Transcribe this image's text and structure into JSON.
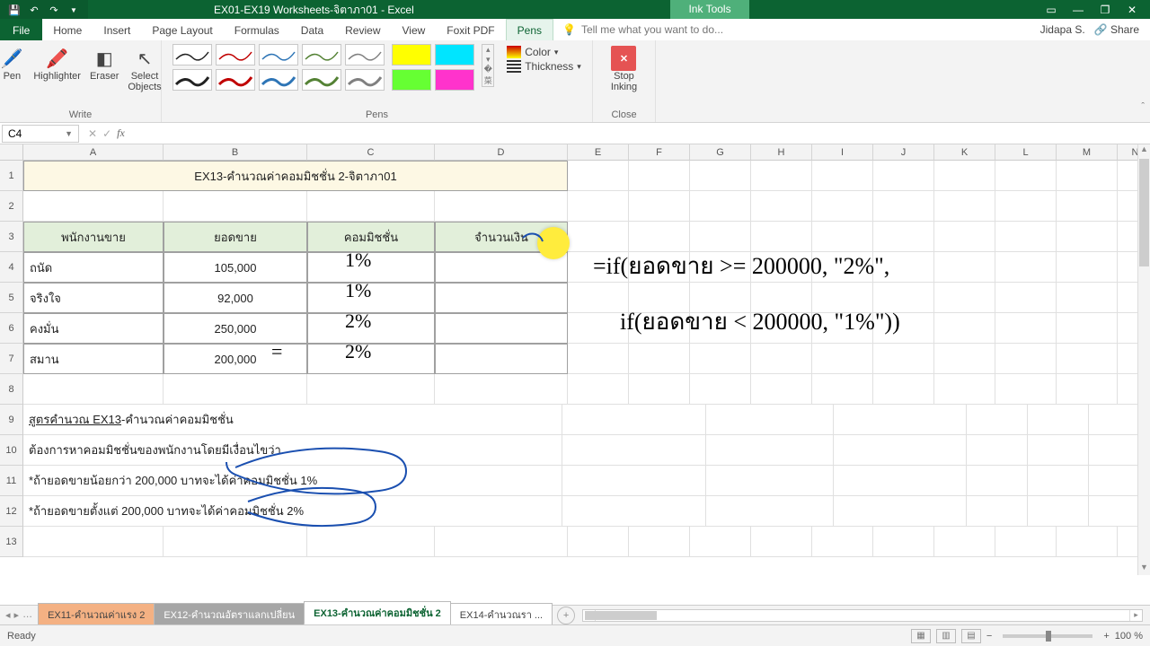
{
  "title": "EX01-EX19  Worksheets-จิตาภา01 - Excel",
  "context_tab": "Ink Tools",
  "user": "Jidapa S.",
  "share": "Share",
  "menutabs": [
    "File",
    "Home",
    "Insert",
    "Page Layout",
    "Formulas",
    "Data",
    "Review",
    "View",
    "Foxit PDF",
    "Pens"
  ],
  "active_tab": "Pens",
  "tellme_placeholder": "Tell me what you want to do...",
  "ribbon": {
    "write": {
      "pen": "Pen",
      "high": "Highlighter",
      "eraser": "Eraser",
      "select": "Select\nObjects",
      "label": "Write"
    },
    "pens_label": "Pens",
    "color": "Color",
    "thickness": "Thickness",
    "stop": "Stop\nInking",
    "close_label": "Close"
  },
  "namebox": "C4",
  "colwidths": {
    "A": 156,
    "B": 160,
    "C": 142,
    "D": 148,
    "E": 68,
    "F": 68,
    "G": 68,
    "H": 68,
    "I": 68,
    "J": 68,
    "K": 68,
    "L": 68,
    "M": 68,
    "N": 40
  },
  "columns": [
    "A",
    "B",
    "C",
    "D",
    "E",
    "F",
    "G",
    "H",
    "I",
    "J",
    "K",
    "L",
    "M",
    "N"
  ],
  "rows": [
    "1",
    "2",
    "3",
    "4",
    "5",
    "6",
    "7",
    "8",
    "9",
    "10",
    "11",
    "12",
    "13"
  ],
  "sheet": {
    "title": "EX13-คำนวณค่าคอมมิชชั่น 2-จิตาภา01",
    "headers": {
      "a": "พนักงานขาย",
      "b": "ยอดขาย",
      "c": "คอมมิชชั่น",
      "d": "จำนวนเงิน"
    },
    "r4": {
      "a": "ถนัด",
      "b": "105,000"
    },
    "r5": {
      "a": "จริงใจ",
      "b": "92,000"
    },
    "r6": {
      "a": "คงมั่น",
      "b": "250,000"
    },
    "r7": {
      "a": "สมาน",
      "b": "200,000"
    },
    "r9": "สูตรคำนวณ EX13-คำนวณค่าคอมมิชชั่น",
    "r10": "ต้องการหาคอมมิชชั่นของพนักงานโดยมีเงื่อนไขว่า",
    "r11": "*ถ้ายอดขายน้อยกว่า 200,000 บาทจะได้ค่าคอมมิชชั่น 1%",
    "r12": "*ถ้ายอดขายตั้งแต่ 200,000 บาทจะได้ค่าคอมมิชชั่น 2%"
  },
  "ink": {
    "c4": "1%",
    "c5": "1%",
    "c6": "2%",
    "c7": "2%",
    "eq": "=",
    "formula1": "=if(ยอดขาย >= 200000, \"2%\",",
    "formula2": "if(ยอดขาย < 200000, \"1%\"))"
  },
  "sheettabs": {
    "t1": "EX11-คำนวณค่าแรง 2",
    "t2": "EX12-คำนวณอัตราแลกเปลี่ยน",
    "t3": "EX13-คำนวณค่าคอมมิชชั่น 2",
    "t4": "EX14-คำนวณรา ..."
  },
  "status": "Ready",
  "zoom": "100 %"
}
